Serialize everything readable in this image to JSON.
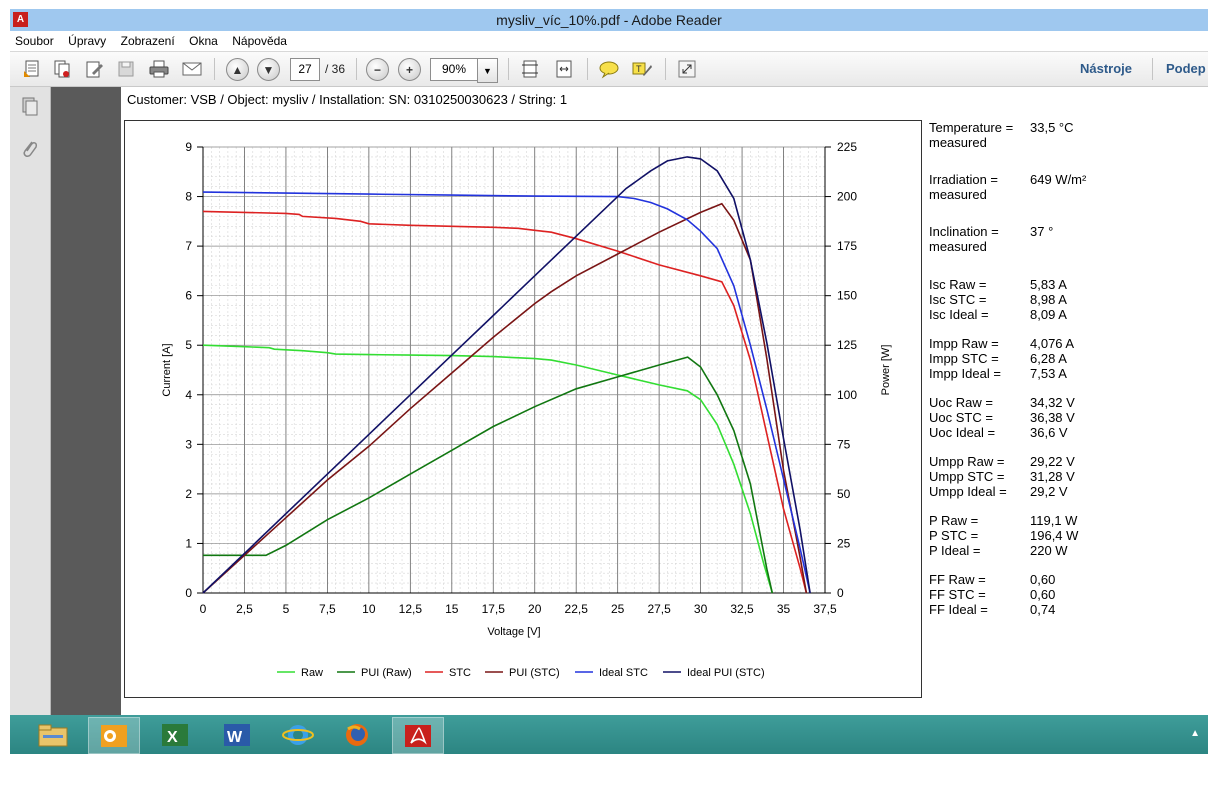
{
  "window": {
    "title": "mysliv_víc_10%.pdf - Adobe Reader",
    "logo_text": "A"
  },
  "menu": [
    "Soubor",
    "Úpravy",
    "Zobrazení",
    "Okna",
    "Nápověda"
  ],
  "toolbar": {
    "page_current": "27",
    "page_total": "/ 36",
    "zoom": "90%",
    "tools_label": "Nástroje",
    "sign_label": "Podep"
  },
  "document": {
    "header": "Customer: VSB / Object: mysliv / Installation: SN: 0310250030623 / String: 1"
  },
  "measurements": [
    {
      "label": "Temperature =\nmeasured",
      "value": "33,5 °C"
    },
    {
      "label": "Irradiation =\nmeasured",
      "value": "649 W/m²"
    },
    {
      "label": "Inclination =\nmeasured",
      "value": "37 °"
    },
    {
      "label": "Isc Raw =",
      "value": "5,83 A"
    },
    {
      "label": "Isc STC =",
      "value": "8,98 A"
    },
    {
      "label": "Isc Ideal =",
      "value": "8,09 A"
    },
    {
      "label": "Impp Raw =",
      "value": "4,076 A"
    },
    {
      "label": "Impp STC =",
      "value": "6,28 A"
    },
    {
      "label": "Impp Ideal =",
      "value": "7,53 A"
    },
    {
      "label": "Uoc Raw =",
      "value": "34,32 V"
    },
    {
      "label": "Uoc STC =",
      "value": "36,38 V"
    },
    {
      "label": "Uoc Ideal =",
      "value": "36,6 V"
    },
    {
      "label": "Umpp Raw =",
      "value": "29,22 V"
    },
    {
      "label": "Umpp STC =",
      "value": "31,28 V"
    },
    {
      "label": "Umpp Ideal =",
      "value": "29,2 V"
    },
    {
      "label": "P Raw =",
      "value": "119,1 W"
    },
    {
      "label": "P STC =",
      "value": "196,4 W"
    },
    {
      "label": "P Ideal =",
      "value": "220 W"
    },
    {
      "label": "FF Raw =",
      "value": "0,60"
    },
    {
      "label": "FF STC =",
      "value": "0,60"
    },
    {
      "label": "FF Ideal =",
      "value": "0,74"
    }
  ],
  "chart_data": {
    "type": "line",
    "xlabel": "Voltage [V]",
    "ylabel": "Current [A]",
    "y2label": "Power [W]",
    "xlim": [
      0,
      37.5
    ],
    "ylim": [
      0,
      9
    ],
    "y2lim": [
      0,
      225
    ],
    "x_ticks": [
      "0",
      "2,5",
      "5",
      "7,5",
      "10",
      "12,5",
      "15",
      "17,5",
      "20",
      "22,5",
      "25",
      "27,5",
      "30",
      "32,5",
      "35",
      "37,5"
    ],
    "y_ticks": [
      "0",
      "1",
      "2",
      "3",
      "4",
      "5",
      "6",
      "7",
      "8",
      "9"
    ],
    "y2_ticks": [
      "0",
      "25",
      "50",
      "75",
      "100",
      "125",
      "150",
      "175",
      "200",
      "225"
    ],
    "grid": true,
    "legend_position": "bottom",
    "series": [
      {
        "name": "Raw",
        "axis": "current",
        "color": "#33dd33",
        "points": [
          [
            0,
            5.0
          ],
          [
            2.5,
            4.97
          ],
          [
            4,
            4.95
          ],
          [
            4.3,
            4.92
          ],
          [
            6,
            4.89
          ],
          [
            7.5,
            4.85
          ],
          [
            8,
            4.82
          ],
          [
            10,
            4.81
          ],
          [
            12.5,
            4.8
          ],
          [
            15,
            4.79
          ],
          [
            17.5,
            4.77
          ],
          [
            20,
            4.73
          ],
          [
            21,
            4.7
          ],
          [
            22.5,
            4.6
          ],
          [
            25,
            4.4
          ],
          [
            27.5,
            4.2
          ],
          [
            29.2,
            4.08
          ],
          [
            30,
            3.9
          ],
          [
            31,
            3.4
          ],
          [
            32,
            2.6
          ],
          [
            33,
            1.6
          ],
          [
            33.8,
            0.6
          ],
          [
            34.32,
            0
          ]
        ]
      },
      {
        "name": "PUI (Raw)",
        "axis": "power",
        "color": "#117711",
        "points": [
          [
            0,
            19
          ],
          [
            3.8,
            19
          ],
          [
            5,
            24
          ],
          [
            7.5,
            37
          ],
          [
            10,
            48
          ],
          [
            12.5,
            60
          ],
          [
            15,
            72
          ],
          [
            17.5,
            84
          ],
          [
            20,
            94
          ],
          [
            22.5,
            103
          ],
          [
            25,
            109
          ],
          [
            27.5,
            115
          ],
          [
            29.22,
            119
          ],
          [
            30,
            114
          ],
          [
            31,
            100
          ],
          [
            32,
            82
          ],
          [
            33,
            55
          ],
          [
            34,
            12
          ],
          [
            34.32,
            0
          ]
        ]
      },
      {
        "name": "STC",
        "axis": "current",
        "color": "#dd2222",
        "points": [
          [
            0,
            7.7
          ],
          [
            2.5,
            7.68
          ],
          [
            5,
            7.66
          ],
          [
            5.8,
            7.64
          ],
          [
            6,
            7.6
          ],
          [
            8,
            7.56
          ],
          [
            9.5,
            7.5
          ],
          [
            10,
            7.45
          ],
          [
            12.5,
            7.42
          ],
          [
            15,
            7.4
          ],
          [
            17.5,
            7.38
          ],
          [
            19,
            7.36
          ],
          [
            20,
            7.32
          ],
          [
            21,
            7.28
          ],
          [
            22.5,
            7.15
          ],
          [
            25,
            6.9
          ],
          [
            27.5,
            6.62
          ],
          [
            30,
            6.4
          ],
          [
            31.28,
            6.28
          ],
          [
            32,
            5.8
          ],
          [
            33,
            4.7
          ],
          [
            34,
            3.2
          ],
          [
            35,
            1.7
          ],
          [
            36,
            0.5
          ],
          [
            36.38,
            0
          ]
        ]
      },
      {
        "name": "PUI (STC)",
        "axis": "power",
        "color": "#7a1515",
        "points": [
          [
            0,
            0
          ],
          [
            2.5,
            19
          ],
          [
            5,
            38
          ],
          [
            7.5,
            57
          ],
          [
            10,
            74
          ],
          [
            12.5,
            93
          ],
          [
            15,
            111
          ],
          [
            17.5,
            129
          ],
          [
            20,
            146
          ],
          [
            21,
            152
          ],
          [
            22.5,
            160
          ],
          [
            25,
            171
          ],
          [
            27.5,
            182
          ],
          [
            30,
            192
          ],
          [
            31.28,
            196.4
          ],
          [
            32,
            188
          ],
          [
            33,
            168
          ],
          [
            34,
            118
          ],
          [
            35,
            62
          ],
          [
            36,
            18
          ],
          [
            36.38,
            0
          ]
        ]
      },
      {
        "name": "Ideal STC",
        "axis": "current",
        "color": "#2233dd",
        "points": [
          [
            0,
            8.09
          ],
          [
            5,
            8.07
          ],
          [
            10,
            8.05
          ],
          [
            15,
            8.03
          ],
          [
            20,
            8.01
          ],
          [
            25,
            8.0
          ],
          [
            26,
            7.96
          ],
          [
            27,
            7.88
          ],
          [
            28,
            7.75
          ],
          [
            29.2,
            7.53
          ],
          [
            30,
            7.3
          ],
          [
            31,
            6.95
          ],
          [
            32,
            6.2
          ],
          [
            33,
            5.0
          ],
          [
            34,
            3.7
          ],
          [
            35,
            2.3
          ],
          [
            36,
            0.9
          ],
          [
            36.6,
            0
          ]
        ]
      },
      {
        "name": "Ideal PUI (STC)",
        "axis": "power",
        "color": "#111166",
        "points": [
          [
            0,
            0
          ],
          [
            2.5,
            20
          ],
          [
            5,
            40
          ],
          [
            7.5,
            60
          ],
          [
            10,
            80
          ],
          [
            12.5,
            100
          ],
          [
            15,
            120
          ],
          [
            17.5,
            140
          ],
          [
            20,
            160
          ],
          [
            22.5,
            180
          ],
          [
            25,
            200
          ],
          [
            25.5,
            204
          ],
          [
            26,
            207
          ],
          [
            27,
            213
          ],
          [
            28,
            218
          ],
          [
            29.2,
            220
          ],
          [
            30,
            219
          ],
          [
            31,
            213
          ],
          [
            32,
            199
          ],
          [
            33,
            168
          ],
          [
            34,
            126
          ],
          [
            35,
            78
          ],
          [
            36,
            32
          ],
          [
            36.6,
            0
          ]
        ]
      }
    ]
  }
}
